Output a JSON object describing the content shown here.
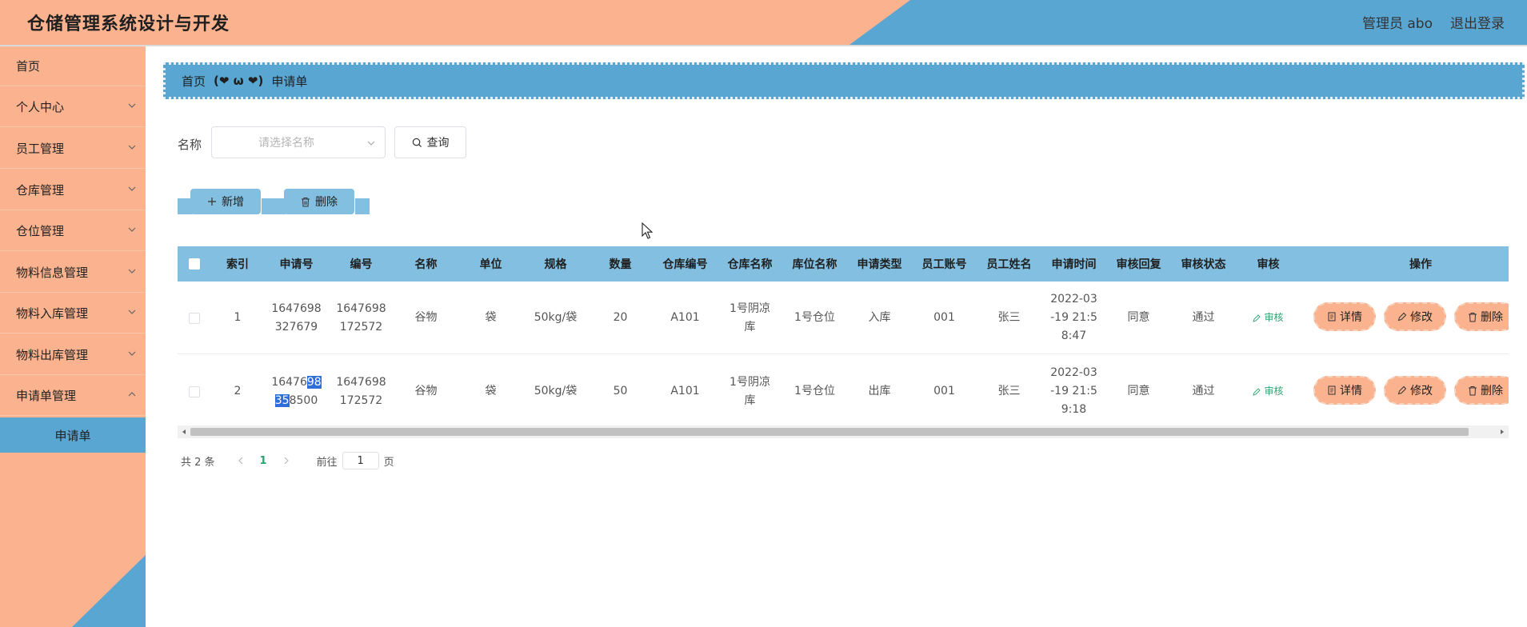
{
  "header": {
    "title": "仓储管理系统设计与开发",
    "user": "管理员 abo",
    "logout": "退出登录",
    "colors": {
      "peach": "#fbb28e",
      "blue": "#5aa6d3"
    }
  },
  "sidebar": {
    "items": [
      {
        "label": "首页"
      },
      {
        "label": "个人中心"
      },
      {
        "label": "员工管理"
      },
      {
        "label": "仓库管理"
      },
      {
        "label": "仓位管理"
      },
      {
        "label": "物料信息管理"
      },
      {
        "label": "物料入库管理"
      },
      {
        "label": "物料出库管理"
      },
      {
        "label": "申请单管理"
      }
    ],
    "sub_active": "申请单"
  },
  "breadcrumb": {
    "home": "首页",
    "separator": "(❤ ω ❤)",
    "current": "申请单"
  },
  "search": {
    "label": "名称",
    "placeholder": "请选择名称",
    "button": "查询"
  },
  "actions": {
    "add": "新增",
    "delete": "删除"
  },
  "table": {
    "columns": [
      "索引",
      "申请号",
      "编号",
      "名称",
      "单位",
      "规格",
      "数量",
      "仓库编号",
      "仓库名称",
      "库位名称",
      "申请类型",
      "员工账号",
      "员工姓名",
      "申请时间",
      "审核回复",
      "审核状态",
      "审核",
      "操作"
    ],
    "rows": [
      {
        "index": "1",
        "apply_no_a": "1647698",
        "apply_no_b": "327679",
        "code_a": "1647698",
        "code_b": "172572",
        "name": "谷物",
        "unit": "袋",
        "spec": "50kg/袋",
        "qty": "20",
        "wh_code": "A101",
        "wh_name_a": "1号阴凉",
        "wh_name_b": "库",
        "loc_name": "1号仓位",
        "type": "入库",
        "emp_acct": "001",
        "emp_name": "张三",
        "time_a": "2022-03",
        "time_b": "-19 21:5",
        "time_c": "8:47",
        "reply": "同意",
        "status": "通过",
        "audit": "审核"
      },
      {
        "index": "2",
        "apply_no_a1": "16476",
        "apply_no_a2": "98",
        "apply_no_b1": "35",
        "apply_no_b2": "8500",
        "code_a": "1647698",
        "code_b": "172572",
        "name": "谷物",
        "unit": "袋",
        "spec": "50kg/袋",
        "qty": "50",
        "wh_code": "A101",
        "wh_name_a": "1号阴凉",
        "wh_name_b": "库",
        "loc_name": "1号仓位",
        "type": "出库",
        "emp_acct": "001",
        "emp_name": "张三",
        "time_a": "2022-03",
        "time_b": "-19 21:5",
        "time_c": "9:18",
        "reply": "同意",
        "status": "通过",
        "audit": "审核"
      }
    ],
    "ops": {
      "detail": "详情",
      "edit": "修改",
      "delete": "删除"
    }
  },
  "pagination": {
    "total": "共 2 条",
    "current": "1",
    "goto": "前往",
    "input": "1",
    "unit": "页"
  }
}
